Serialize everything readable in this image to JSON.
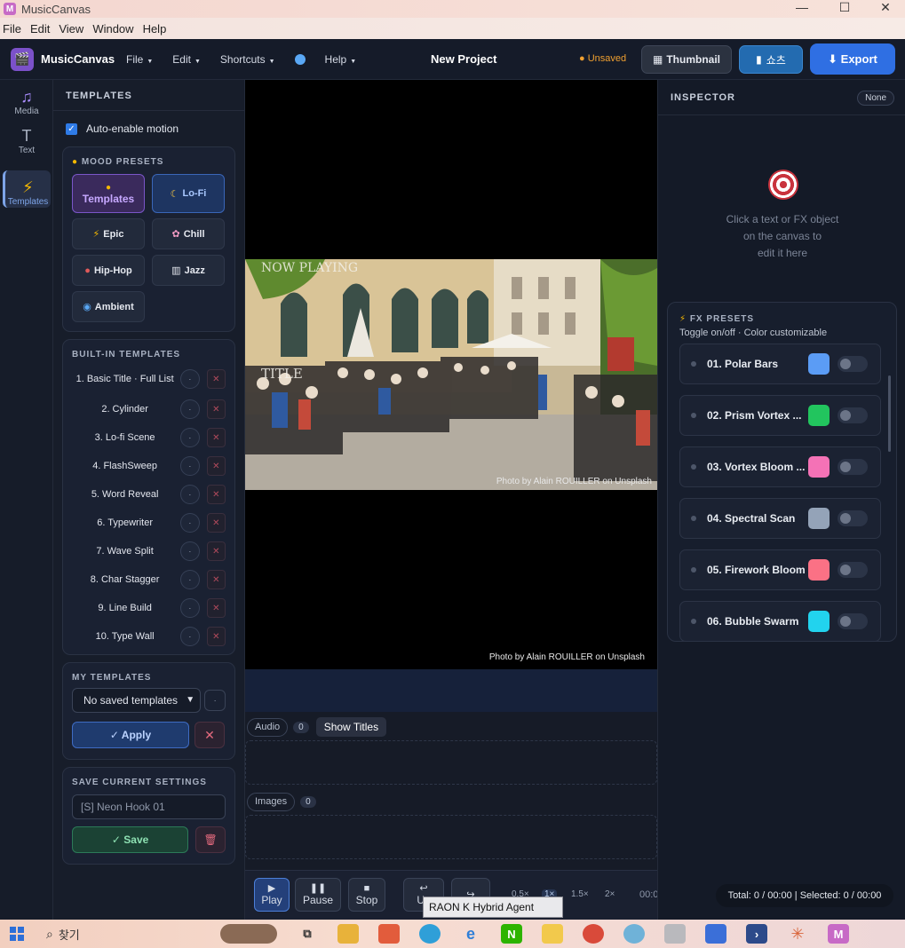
{
  "os": {
    "app_title": "MusicCanvas",
    "menu": [
      "File",
      "Edit",
      "View",
      "Window",
      "Help"
    ],
    "minimize": "—",
    "maximize": "☐",
    "close": "✕"
  },
  "appbar": {
    "brand": "MusicCanvas",
    "menus": [
      {
        "label": "File"
      },
      {
        "label": "Edit"
      },
      {
        "label": "Shortcuts"
      },
      {
        "label": "Help"
      }
    ],
    "project_title": "New Project",
    "status": "● Unsaved",
    "thumbnail_label": "Thumbnail",
    "shorts_label": "쇼츠",
    "export_label": "⬇ Export"
  },
  "rail": [
    {
      "label": "Media",
      "icon": "♫"
    },
    {
      "label": "Text",
      "icon": "T"
    },
    {
      "label": "Templates",
      "icon": "⚡"
    }
  ],
  "templates_panel": {
    "title": "TEMPLATES",
    "auto_motion_label": "Auto-enable motion",
    "mood_title": "MOOD PRESETS",
    "moods": [
      "Templates",
      "Lo-Fi",
      "Epic",
      "Chill",
      "Hip-Hop",
      "Jazz",
      "Ambient"
    ],
    "builtin_title": "BUILT-IN TEMPLATES",
    "builtin": [
      "1. Basic Title · Full List",
      "2. Cylinder",
      "3. Lo-fi Scene",
      "4. FlashSweep",
      "5. Word Reveal",
      "6. Typewriter",
      "7. Wave Split",
      "8. Char Stagger",
      "9. Line Build",
      "10. Type Wall"
    ],
    "my_title": "MY TEMPLATES",
    "my_select": "No saved templates",
    "apply_label": "✓ Apply",
    "save_title": "SAVE CURRENT SETTINGS",
    "name_value": "[S] Neon Hook 01",
    "save_label": "✓ Save"
  },
  "canvas": {
    "now_playing": "NOW PLAYING",
    "title_overlay": "TITLE",
    "credit_inner": "Photo by Alain ROUILLER on Unsplash",
    "credit_outer": "Photo by Alain ROUILLER on Unsplash"
  },
  "tracks": {
    "audio_label": "Audio",
    "audio_count": "0",
    "show_titles": "Show Titles",
    "images_label": "Images",
    "images_count": "0"
  },
  "transport": {
    "play": "Play",
    "pause": "Pause",
    "stop": "Stop",
    "undo": "Un",
    "speeds": [
      "0.5×",
      "1×",
      "1.5×",
      "2×"
    ],
    "selected_speed": "1×",
    "time": "00:0"
  },
  "inspector": {
    "title": "INSPECTOR",
    "selection": "None",
    "message_lines": [
      "Click a text or FX object",
      "on the canvas to",
      "edit it here"
    ],
    "fx_title": "FX PRESETS",
    "fx_subtitle": "Toggle on/off · Color customizable",
    "fx": [
      {
        "name": "01. Polar Bars",
        "color": "#5b9cf5"
      },
      {
        "name": "02. Prism Vortex ...",
        "color": "#22c55e"
      },
      {
        "name": "03. Vortex Bloom ...",
        "color": "#f472b6"
      },
      {
        "name": "04. Spectral Scan",
        "color": "#94a3b8"
      },
      {
        "name": "05. Firework Bloom",
        "color": "#fb7185"
      },
      {
        "name": "06. Bubble Swarm",
        "color": "#22d3ee"
      }
    ]
  },
  "status": {
    "total": "Total: 0 / 00:00 | Selected: 0 / 00:00",
    "tooltip": "RAON K Hybrid Agent"
  },
  "taskbar": {
    "search": "찾기"
  }
}
